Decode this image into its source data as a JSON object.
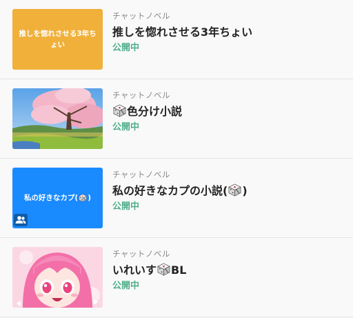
{
  "items": [
    {
      "thumb_text": "推しを惚れさせる3年ちょい",
      "category": "チャットノベル",
      "title": "推しを惚れさせる3年ちょい",
      "status": "公開中"
    },
    {
      "category": "チャットノベル",
      "title_text": "色分け小説",
      "status": "公開中"
    },
    {
      "thumb_text": "私の好きなカプ(",
      "thumb_text_end": ")",
      "category": "チャットノベル",
      "title_text": "私の好きなカプの小説(",
      "title_text_end": ")",
      "status": "公開中"
    },
    {
      "category": "チャットノベル",
      "title_text": "いれいす",
      "title_text_end": "BL",
      "status": "公開中"
    }
  ],
  "colors": {
    "accent_green": "#4fae8a",
    "thumb1_bg": "#f0b039",
    "thumb3_bg": "#1a8aff"
  },
  "icons": [
    "dice-icon",
    "group-icon"
  ]
}
